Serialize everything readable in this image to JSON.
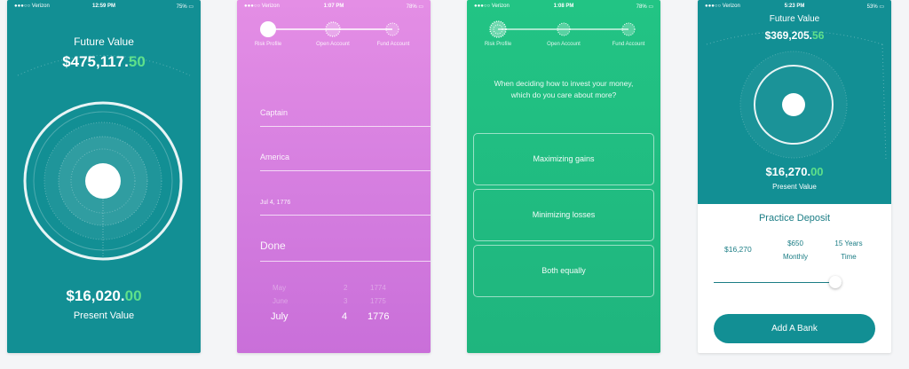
{
  "phone1": {
    "status": {
      "carrier": "●●●○○ Verizon",
      "time": "12:59 PM",
      "battery": "75% ▭"
    },
    "future_label": "Future Value",
    "future_dollars": "$475,117.",
    "future_cents": "50",
    "present_dollars": "$16,020.",
    "present_cents": "00",
    "present_label": "Present Value"
  },
  "phone2": {
    "status": {
      "carrier": "●●●○○ Verizon",
      "time": "1:07 PM",
      "battery": "78% ▭"
    },
    "steps": [
      "Risk Profile",
      "Open Account",
      "Fund Account"
    ],
    "fields": [
      "Captain",
      "America",
      "Jul 4, 1776"
    ],
    "done_label": "Done",
    "picker_above": [
      {
        "month": "May",
        "day": "2",
        "year": "1774"
      },
      {
        "month": "June",
        "day": "3",
        "year": "1775"
      }
    ],
    "picker_selected": {
      "month": "July",
      "day": "4",
      "year": "1776"
    }
  },
  "phone3": {
    "status": {
      "carrier": "●●●○○ Verizon",
      "time": "1:08 PM",
      "battery": "78% ▭"
    },
    "steps": [
      "Risk Profile",
      "Open Account",
      "Fund Account"
    ],
    "question": [
      "When deciding how to invest your money,",
      "which do you care about more?"
    ],
    "options": [
      "Maximizing gains",
      "Minimizing losses",
      "Both equally"
    ]
  },
  "phone4": {
    "status": {
      "carrier": "●●●○○ Verizon",
      "time": "5:23 PM",
      "battery": "53% ▭"
    },
    "future_label": "Future Value",
    "future_dollars": "$369,205.",
    "future_cents": "56",
    "present_dollars": "$16,270.",
    "present_cents": "00",
    "present_label": "Present Value",
    "practice_title": "Practice Deposit",
    "amount": "$16,270",
    "monthly_value": "$650",
    "monthly_label": "Monthly",
    "years_value": "15 Years",
    "years_label": "Time",
    "slider_level": 0.75,
    "add_bank_label": "Add A Bank"
  },
  "colors": {
    "teal": "#128f94",
    "green_accent": "#5ee08a",
    "purple": "#d67fe0",
    "green_bg": "#1fb57e"
  }
}
